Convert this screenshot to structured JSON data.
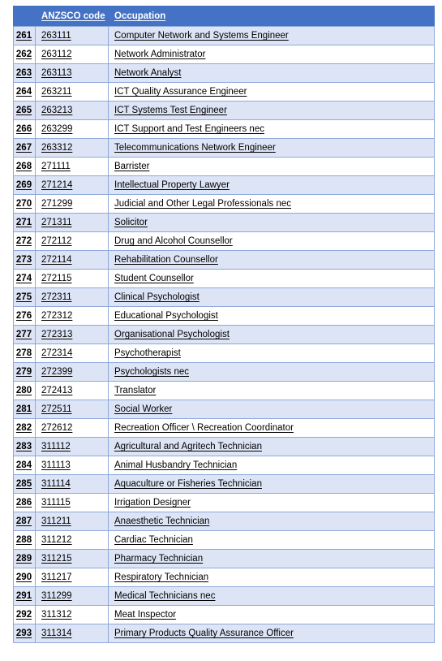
{
  "table": {
    "name": "anzsco-occupation-list",
    "colors": {
      "header_background": "#4472C4",
      "header_text": "#FFFFFF",
      "border": "#8EAADB",
      "row_shaded": "#DCE4F5",
      "row_plain": "#FFFFFF",
      "body_text": "#000000"
    },
    "columns": [
      {
        "key": "num",
        "label": ""
      },
      {
        "key": "anzsco_code",
        "label": "ANZSCO code"
      },
      {
        "key": "occupation",
        "label": "Occupation"
      }
    ],
    "rows": [
      {
        "num": "261",
        "code": "263111",
        "occupation": "Computer Network and Systems Engineer"
      },
      {
        "num": "262",
        "code": "263112",
        "occupation": "Network Administrator"
      },
      {
        "num": "263",
        "code": "263113",
        "occupation": "Network Analyst"
      },
      {
        "num": "264",
        "code": "263211",
        "occupation": "ICT Quality Assurance Engineer"
      },
      {
        "num": "265",
        "code": "263213",
        "occupation": "ICT Systems Test Engineer"
      },
      {
        "num": "266",
        "code": "263299",
        "occupation": "ICT Support and Test Engineers nec"
      },
      {
        "num": "267",
        "code": "263312",
        "occupation": "Telecommunications Network Engineer"
      },
      {
        "num": "268",
        "code": "271111",
        "occupation": "Barrister"
      },
      {
        "num": "269",
        "code": "271214",
        "occupation": "Intellectual Property Lawyer"
      },
      {
        "num": "270",
        "code": "271299",
        "occupation": "Judicial and Other Legal Professionals nec"
      },
      {
        "num": "271",
        "code": "271311",
        "occupation": "Solicitor"
      },
      {
        "num": "272",
        "code": "272112",
        "occupation": "Drug and Alcohol Counsellor"
      },
      {
        "num": "273",
        "code": "272114",
        "occupation": "Rehabilitation Counsellor"
      },
      {
        "num": "274",
        "code": "272115",
        "occupation": "Student Counsellor"
      },
      {
        "num": "275",
        "code": "272311",
        "occupation": "Clinical Psychologist"
      },
      {
        "num": "276",
        "code": "272312",
        "occupation": "Educational Psychologist"
      },
      {
        "num": "277",
        "code": "272313",
        "occupation": "Organisational Psychologist"
      },
      {
        "num": "278",
        "code": "272314",
        "occupation": "Psychotherapist"
      },
      {
        "num": "279",
        "code": "272399",
        "occupation": "Psychologists nec"
      },
      {
        "num": "280",
        "code": "272413",
        "occupation": "Translator"
      },
      {
        "num": "281",
        "code": "272511",
        "occupation": "Social Worker"
      },
      {
        "num": "282",
        "code": "272612",
        "occupation": "Recreation Officer \\ Recreation Coordinator"
      },
      {
        "num": "283",
        "code": "311112",
        "occupation": "Agricultural and Agritech Technician"
      },
      {
        "num": "284",
        "code": "311113",
        "occupation": "Animal Husbandry Technician"
      },
      {
        "num": "285",
        "code": "311114",
        "occupation": "Aquaculture or Fisheries Technician"
      },
      {
        "num": "286",
        "code": "311115",
        "occupation": "Irrigation Designer"
      },
      {
        "num": "287",
        "code": "311211",
        "occupation": "Anaesthetic Technician"
      },
      {
        "num": "288",
        "code": "311212",
        "occupation": "Cardiac Technician"
      },
      {
        "num": "289",
        "code": "311215",
        "occupation": "Pharmacy Technician"
      },
      {
        "num": "290",
        "code": "311217",
        "occupation": "Respiratory Technician"
      },
      {
        "num": "291",
        "code": "311299",
        "occupation": "Medical Technicians nec"
      },
      {
        "num": "292",
        "code": "311312",
        "occupation": "Meat Inspector"
      },
      {
        "num": "293",
        "code": "311314",
        "occupation": "Primary Products Quality Assurance Officer"
      }
    ]
  }
}
